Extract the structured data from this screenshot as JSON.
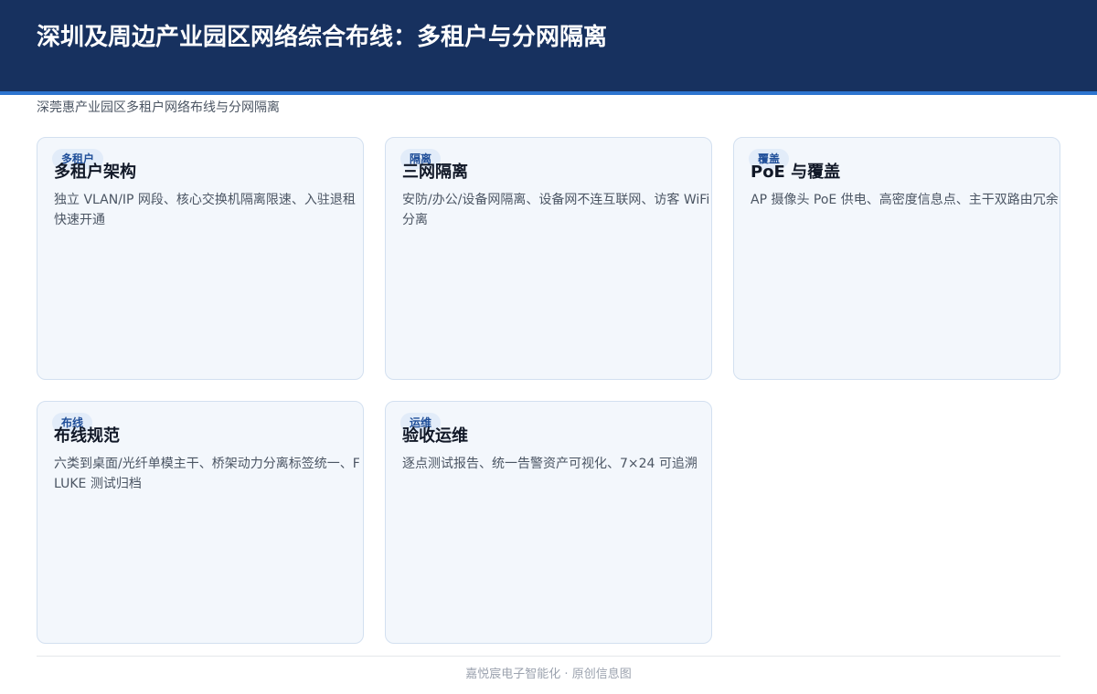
{
  "header": {
    "title": "深圳及周边产业园区网络综合布线：多租户与分网隔离"
  },
  "subtitle": "深莞惠产业园区多租户网络布线与分网隔离",
  "cards": [
    {
      "tag": "多租户",
      "title": "多租户架构",
      "desc": "独立 VLAN/IP 网段、核心交换机隔离限速、入驻退租快速开通"
    },
    {
      "tag": "隔离",
      "title": "三网隔离",
      "desc": "安防/办公/设备网隔离、设备网不连互联网、访客 WiFi 分离"
    },
    {
      "tag": "覆盖",
      "title": "PoE 与覆盖",
      "desc": "AP 摄像头 PoE 供电、高密度信息点、主干双路由冗余"
    },
    {
      "tag": "布线",
      "title": "布线规范",
      "desc": "六类到桌面/光纤单模主干、桥架动力分离标签统一、FLUKE 测试归档"
    },
    {
      "tag": "运维",
      "title": "验收运维",
      "desc": "逐点测试报告、统一告警资产可视化、7×24 可追溯"
    }
  ],
  "footer": "嘉悦宸电子智能化 · 原创信息图"
}
